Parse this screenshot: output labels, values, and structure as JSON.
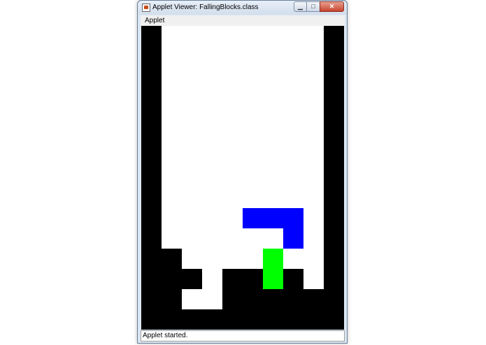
{
  "window": {
    "title": "Applet Viewer: FallingBlocks.class",
    "controls": {
      "minimize_icon": "minimize-icon",
      "maximize_icon": "maximize-icon",
      "close_icon": "close-icon"
    }
  },
  "menubar": {
    "items": [
      "Applet"
    ]
  },
  "board": {
    "columns": 10,
    "rows": 15,
    "colors": {
      "settled": "#000000",
      "blue_piece": "#0000ff",
      "green_piece": "#00ff00",
      "empty": "#ffffff"
    },
    "settled_cells": [
      [
        0,
        0
      ],
      [
        9,
        0
      ],
      [
        0,
        1
      ],
      [
        9,
        1
      ],
      [
        0,
        2
      ],
      [
        9,
        2
      ],
      [
        0,
        3
      ],
      [
        9,
        3
      ],
      [
        0,
        4
      ],
      [
        9,
        4
      ],
      [
        0,
        5
      ],
      [
        9,
        5
      ],
      [
        0,
        6
      ],
      [
        9,
        6
      ],
      [
        0,
        7
      ],
      [
        9,
        7
      ],
      [
        0,
        8
      ],
      [
        9,
        8
      ],
      [
        0,
        9
      ],
      [
        9,
        9
      ],
      [
        0,
        10
      ],
      [
        9,
        10
      ],
      [
        0,
        11
      ],
      [
        1,
        11
      ],
      [
        9,
        11
      ],
      [
        0,
        12
      ],
      [
        1,
        12
      ],
      [
        2,
        12
      ],
      [
        4,
        12
      ],
      [
        5,
        12
      ],
      [
        6,
        12
      ],
      [
        7,
        12
      ],
      [
        9,
        12
      ],
      [
        0,
        13
      ],
      [
        1,
        13
      ],
      [
        4,
        13
      ],
      [
        5,
        13
      ],
      [
        6,
        13
      ],
      [
        7,
        13
      ],
      [
        8,
        13
      ],
      [
        9,
        13
      ],
      [
        0,
        14
      ],
      [
        1,
        14
      ],
      [
        2,
        14
      ],
      [
        3,
        14
      ],
      [
        4,
        14
      ],
      [
        5,
        14
      ],
      [
        6,
        14
      ],
      [
        7,
        14
      ],
      [
        8,
        14
      ],
      [
        9,
        14
      ]
    ],
    "blue_cells": [
      [
        5,
        9
      ],
      [
        6,
        9
      ],
      [
        7,
        9
      ],
      [
        7,
        10
      ]
    ],
    "green_cells": [
      [
        6,
        11
      ],
      [
        6,
        12
      ]
    ]
  },
  "status": {
    "text": "Applet started."
  }
}
